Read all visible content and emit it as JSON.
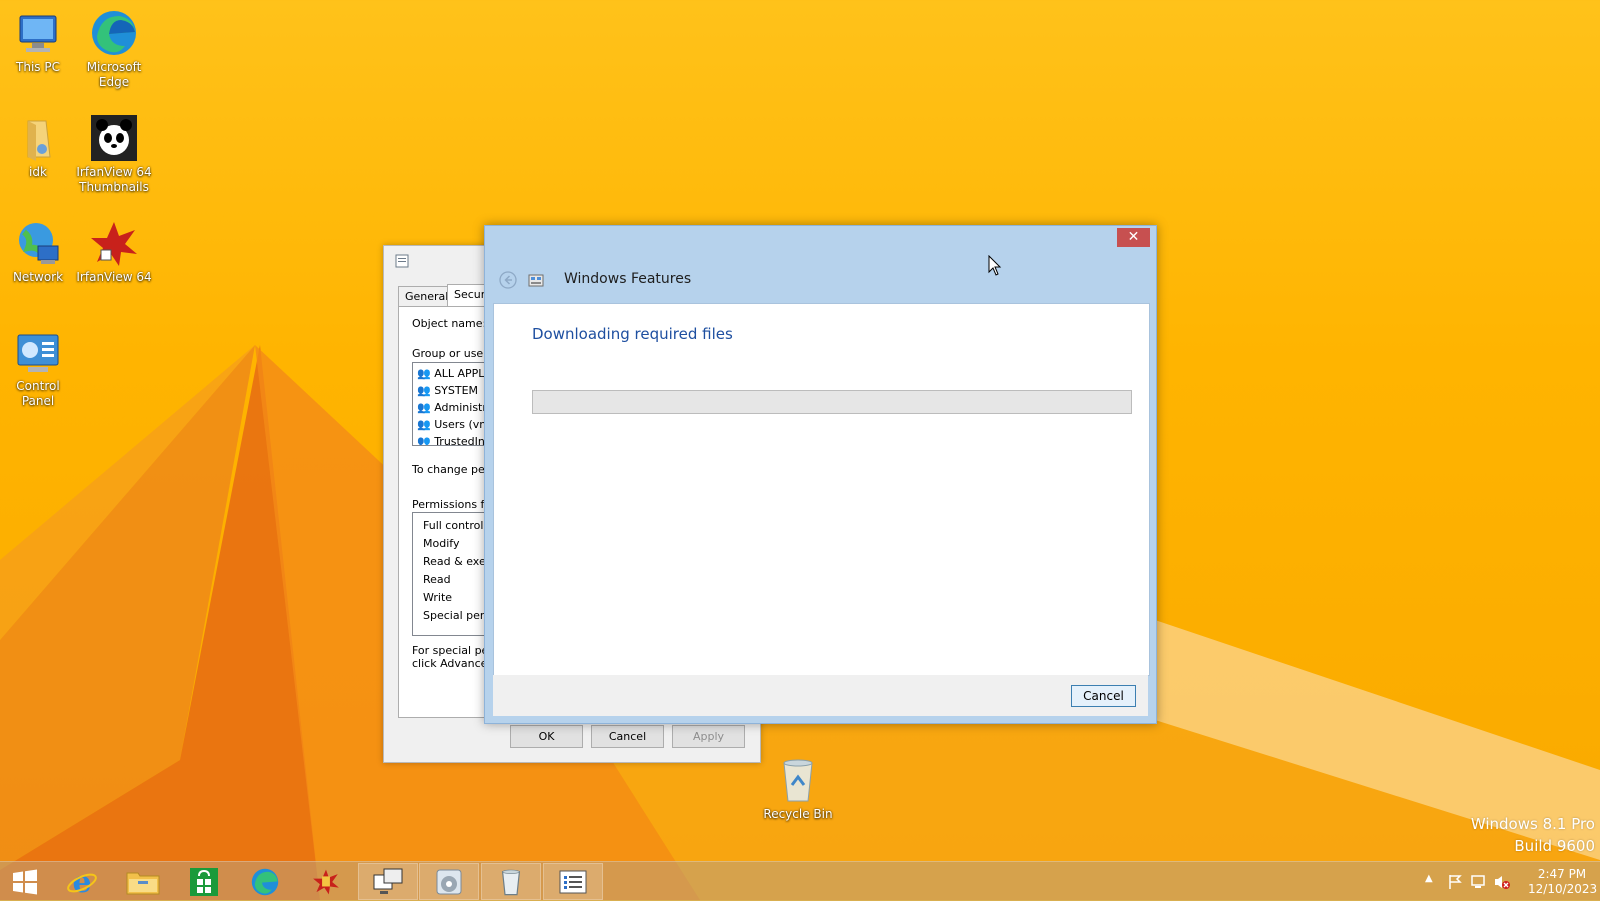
{
  "desktop": {
    "icons": [
      {
        "label": "This PC",
        "icon": "this-pc-icon"
      },
      {
        "label": "Microsoft Edge",
        "icon": "edge-icon"
      },
      {
        "label": "idk",
        "icon": "folder-icon"
      },
      {
        "label": "IrfanView 64 Thumbnails",
        "icon": "irfanview-thumbnails-icon"
      },
      {
        "label": "Network",
        "icon": "network-icon"
      },
      {
        "label": "IrfanView 64",
        "icon": "irfanview-icon"
      },
      {
        "label": "Control Panel",
        "icon": "control-panel-icon"
      },
      {
        "label": "Recycle Bin",
        "icon": "recycle-bin-icon"
      }
    ],
    "watermark": {
      "line1": "Windows 8.1 Pro",
      "line2": "Build 9600"
    }
  },
  "properties_dialog": {
    "tabs": [
      "General",
      "Securi"
    ],
    "object_name_label": "Object name:",
    "group_label": "Group or user n",
    "users": [
      "ALL APPL",
      "SYSTEM",
      "Administra",
      "Users (vm",
      "TrustedIns"
    ],
    "change_text": "To change pern",
    "permissions_label": "Permissions for",
    "permissions": [
      "Full control",
      "Modify",
      "Read & exec",
      "Read",
      "Write",
      "Special perm"
    ],
    "special_text_1": "For special perr",
    "special_text_2": "click Advanced",
    "buttons": {
      "ok": "OK",
      "cancel": "Cancel",
      "apply": "Apply"
    }
  },
  "features_dialog": {
    "title": "Windows Features",
    "close_symbol": "✕",
    "heading": "Downloading required files",
    "progress": 0,
    "cancel_label": "Cancel"
  },
  "taskbar": {
    "items": [
      "start",
      "internet-explorer",
      "file-explorer",
      "store",
      "edge",
      "irfanview",
      "remote-desktop",
      "media-player",
      "recycle-bin",
      "task-list"
    ],
    "clock": {
      "time": "2:47 PM",
      "date": "12/10/2023"
    }
  },
  "colors": {
    "accent": "#ffb400",
    "dialog_frame": "#b6d2ec",
    "heading_blue": "#1e4fa0",
    "close_red": "#c75050"
  }
}
